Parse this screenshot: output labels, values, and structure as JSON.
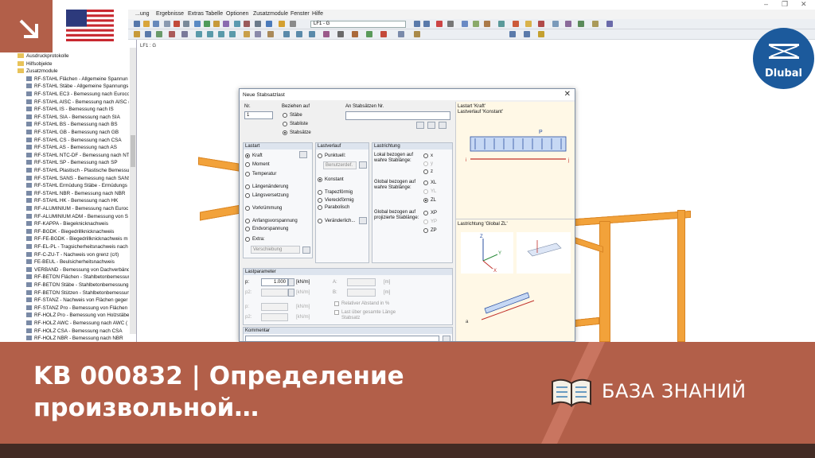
{
  "menubar": {
    "items": [
      "...ung",
      "Ergebnisse",
      "Extras",
      "Tabelle",
      "Optionen",
      "Zusatzmodule",
      "Fenster",
      "Hilfe"
    ]
  },
  "toolbar": {
    "loadcase": "LF1 - G"
  },
  "viewport": {
    "label": "LF1 : G"
  },
  "navigator": {
    "top_items": [
      "Ausdruckprotokolle",
      "Hilfsobjekte",
      "Zusatzmodule"
    ],
    "modules": [
      "RF-STAHL Flächen - Allgemeine Spannun",
      "RF-STAHL Stäbe - Allgemeine Spannungs",
      "RF-STAHL EC3 - Bemessung nach Euroco",
      "RF-STAHL AISC - Bemessung nach AISC (",
      "RF-STAHL IS - Bemessung nach IS",
      "RF-STAHL SIA - Bemessung nach SIA",
      "RF-STAHL BS - Bemessung nach BS",
      "RF-STAHL GB - Bemessung nach GB",
      "RF-STAHL CS - Bemessung nach CSA",
      "RF-STAHL AS - Bemessung nach AS",
      "RF-STAHL NTC-DF - Bemessung nach NT",
      "RF-STAHL SP - Bemessung nach SP",
      "RF-STAHL Plastisch - Plastische Bemessur",
      "RF-STAHL SANS - Bemessung nach SANS",
      "RF-STAHL Ermüdung Stäbe - Ermüdungs",
      "RF-STAHL NBR - Bemessung nach NBR",
      "RF-STAHL HK - Bemessung nach HK",
      "RF-ALUMINIUM - Bemessung nach Euroc",
      "RF-ALUMINIUM ADM - Bemessung von S",
      "RF-KAPPA - Biegeknicknachweis",
      "RF-BGDK - Biegedrillknicknachweis",
      "RF-FE-BGDK - Biegedrillknicknachweis m",
      "RF-EL-PL - Tragsicherheitsnachweis nach",
      "RF-C-ZU-T - Nachweis von grenz (c/t)",
      "FE-BEUL - Beulsicherheitsnachweis",
      "VERBAND - Bemessung von Dachverbänd",
      "RF-BETON Flächen - Stahlbetonbemessur",
      "RF-BETON Stäbe - Stahlbetonbemessung",
      "RF-BETON Stützen - Stahlbetonbemessun",
      "RF-STANZ - Nachweis von Flächen geger",
      "RF-STANZ Pro - Bemessung von Flächen ge",
      "RF-HOLZ Pro - Bemessung von Holzstäbe",
      "RF-HOLZ AWC - Bemessung nach AWC (",
      "RF-HOLZ CSA - Bemessung nach CSA",
      "RF-HOLZ NBR - Bemessung nach NBR"
    ]
  },
  "dialog": {
    "title": "Neue Stabsatzlast",
    "nr_label": "Nr.",
    "nr_value": "1",
    "bezug_label": "Beziehen auf",
    "bezug": [
      "Stäbe",
      "Stabliste",
      "Stabsätze"
    ],
    "an_label": "An Stabsätzen Nr.",
    "lastart_label": "Lastart",
    "lastart": [
      "Kraft",
      "Moment",
      "Temperatur",
      "Längenänderung",
      "Längsversetzung",
      "Vorkrümmung",
      "Anfangsvorspannung",
      "Endvorspannung",
      "Extra:"
    ],
    "extra_value": "Verschiebung",
    "lastverlauf_label": "Lastverlauf",
    "lastverlauf": [
      "Punktuell:",
      "Konstant",
      "Trapezförmig",
      "Viereckförmig",
      "Parabolisch",
      "Veränderlich..."
    ],
    "punkt_value": "Benutzerdef.",
    "lastrichtung_label": "Lastrichtung",
    "lokal_label": "Lokal bezogen auf wahre Stablänge:",
    "global_label": "Global bezogen auf wahre Stablänge:",
    "global_proj_label": "Global bezogen auf projizierte Stablänge:",
    "dirs_local": [
      "x",
      "y",
      "z"
    ],
    "dirs_global": [
      "XL",
      "YL",
      "ZL"
    ],
    "dirs_proj": [
      "XP",
      "YP",
      "ZP"
    ],
    "lastparameter_label": "Lastparameter",
    "p_label": "p:",
    "p_value": "1.000",
    "p_unit": "[kN/m]",
    "p2_label": "p2:",
    "a_label": "A:",
    "b_label": "B:",
    "len_unit": "[m]",
    "rel_label": "Relativer Abstand in %",
    "ueber_label": "Last über gesamte Länge Stabsatz",
    "kommentar_label": "Kommentar",
    "preview_title1": "Lastart 'Kraft'",
    "preview_title2": "Lastverlauf 'Konstant'",
    "preview_p": "P",
    "preview_i": "i",
    "preview_j": "j",
    "preview_dir_title": "Lastrichtung 'Global ZL'",
    "axis_x": "X",
    "axis_y": "Y",
    "axis_z": "Z",
    "axis_a": "a"
  },
  "overlay": {
    "headline": "KB 000832 | Определение произвольной…",
    "kb_label": "БАЗА ЗНАНИЙ",
    "brand": "Dlubal"
  },
  "colors": {
    "overlay": "#b25f49",
    "beam": "#f2a23a",
    "brand": "#1c5a9c",
    "strip": "#432b24"
  }
}
